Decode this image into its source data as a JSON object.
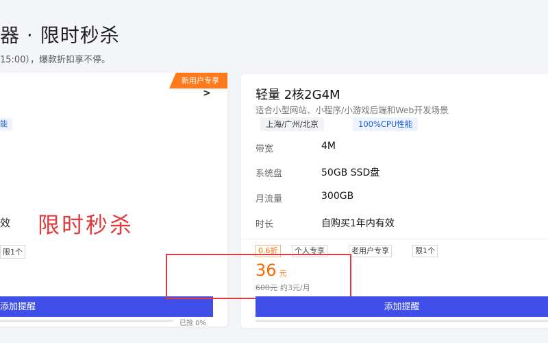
{
  "page": {
    "title": "器 · 限时秒杀",
    "subtitle": "15:00），爆款折扣享不停。"
  },
  "left_card": {
    "badge": "新用户专享",
    "arrow": ">",
    "perf_tag_fragment": "能",
    "validity_fragment": "效",
    "promo_overlay": "限时秒杀",
    "limit_tag_fragment": "限1个",
    "button_label": "添加提醒",
    "sold_label": "已抢 0%",
    "sold_progress": 0
  },
  "right_card": {
    "title": "轻量 2核2G4M",
    "description": "适合小型网站、小程序/小游戏后端和Web开发场景",
    "tags": [
      "上海/广州/北京",
      "100%CPU性能"
    ],
    "specs": [
      {
        "key": "带宽",
        "value": "4M"
      },
      {
        "key": "系统盘",
        "value": "50GB SSD盘"
      },
      {
        "key": "月流量",
        "value": "300GB"
      },
      {
        "key": "时长",
        "value": "自购买1年内有效"
      }
    ],
    "price_tags": [
      "0.6折",
      "个人专享",
      "老用户专享",
      "限1个"
    ],
    "price": "36",
    "price_unit": "元",
    "original_price": "600元",
    "monthly": "约3元/月",
    "button_label": "添加提醒",
    "sold_progress": 0
  },
  "colors": {
    "accent": "#3f4fe8",
    "price": "#ff6a00",
    "highlight": "#e23a3a"
  }
}
